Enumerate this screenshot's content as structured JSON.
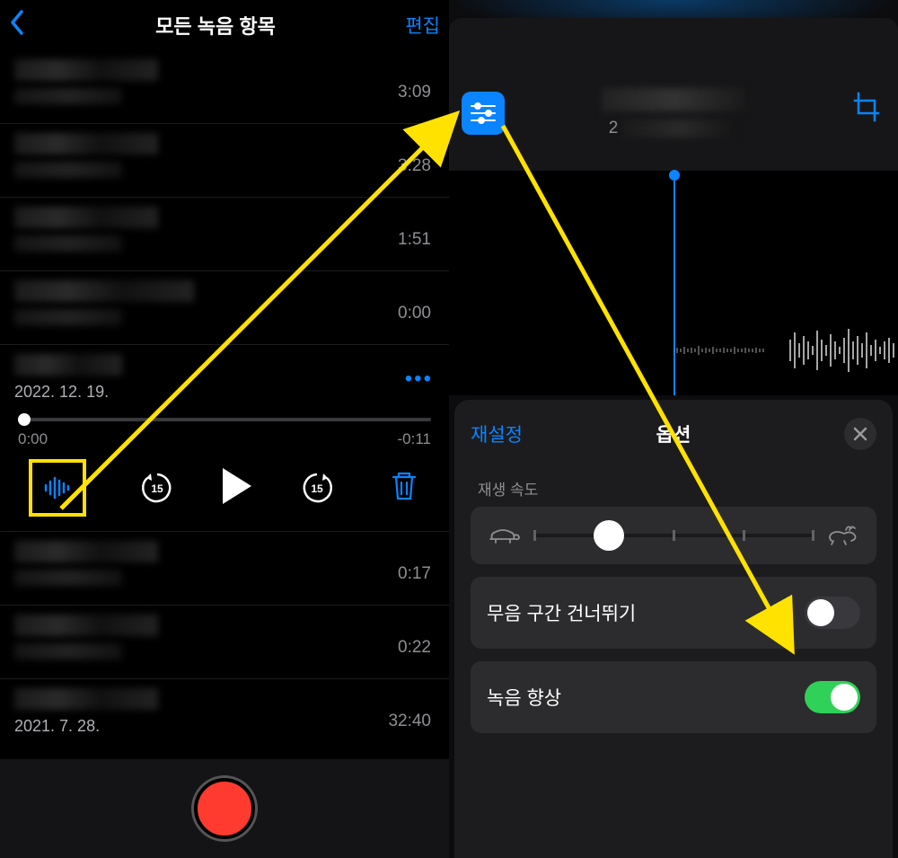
{
  "left": {
    "header": {
      "title": "모든 녹음 항목",
      "edit": "편집"
    },
    "rows": [
      {
        "duration": "3:09"
      },
      {
        "duration": "3:28"
      },
      {
        "duration": "1:51"
      },
      {
        "duration": "0:00"
      }
    ],
    "selected": {
      "date": "2022. 12. 19.",
      "pos": "0:00",
      "remain": "-0:11"
    },
    "rows_after": [
      {
        "duration": "0:17"
      },
      {
        "duration": "0:22"
      },
      {
        "date": "2021. 7. 28.",
        "duration": "32:40"
      }
    ]
  },
  "right": {
    "sub_prefix": "2",
    "sheet": {
      "reset": "재설정",
      "title": "옵션",
      "speed_label": "재생 속도",
      "skip_silence": "무음 구간 건너뛰기",
      "enhance": "녹음 향상",
      "skip_on": false,
      "enhance_on": true
    }
  }
}
